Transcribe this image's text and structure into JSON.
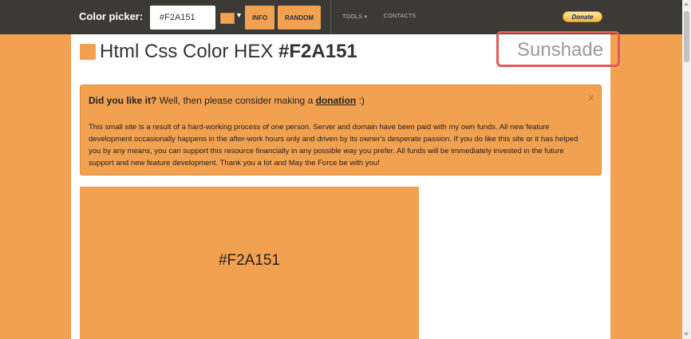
{
  "colors": {
    "accent": "#F2A151",
    "topbar": "#3b3a36",
    "highlight": "#e05a5a"
  },
  "topbar": {
    "label": "Color picker:",
    "hex_value": "#F2A151",
    "info_label": "INFO",
    "random_label": "RANDOM",
    "tools_label": "TOOLS",
    "contacts_label": "CONTACTS",
    "donate_label": "Donate"
  },
  "header": {
    "title_prefix": "Html Css Color HEX",
    "title_hex": "#F2A151",
    "color_name": "Sunshade"
  },
  "alert": {
    "question": "Did you like it?",
    "text_mid": "Well, then please consider making a",
    "link": "donation",
    "text_end": ":)",
    "close": "x",
    "body": "This small site is a result of a hard-working process of one person. Server and domain have been paid with my own funds. All new feature development occasionally happens in the after-work hours only and driven by its owner's desperate passion. If you do like this site or it has helped you by any means, you can support this resource financially in any possible way you prefer. All funds will be immediately invested in the future support and new feature development. Thank you a lot and May the Force be with you!"
  },
  "swatch": {
    "label": "#F2A151"
  }
}
